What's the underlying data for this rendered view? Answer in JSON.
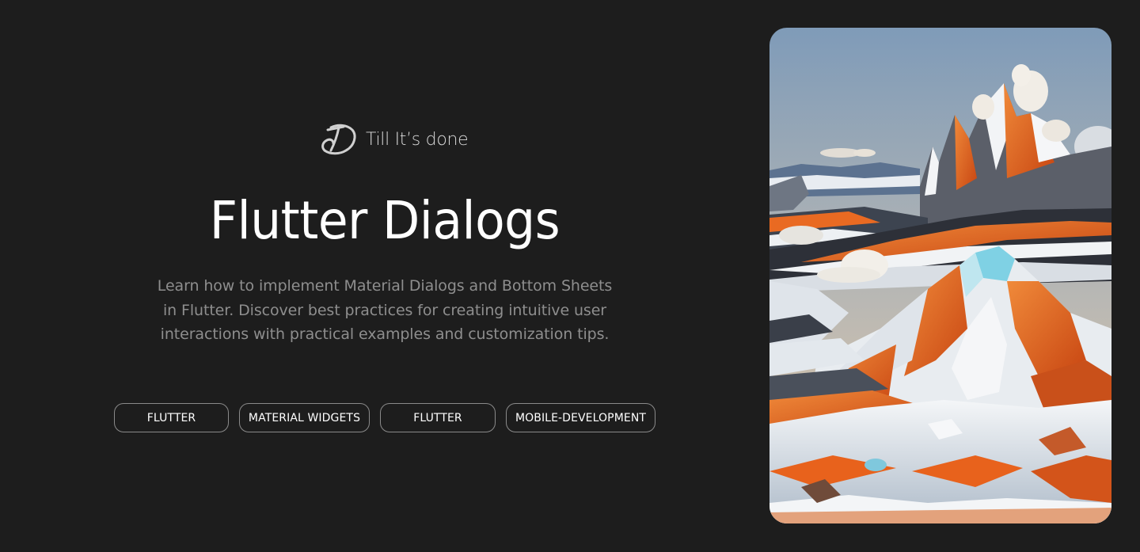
{
  "brand": {
    "name": "Till It’s done",
    "logo_icon": "td-monogram-logo"
  },
  "hero": {
    "title": "Flutter Dialogs",
    "description": "Learn how to implement Material Dialogs and Bottom Sheets in Flutter. Discover best practices for creating intuitive user interactions with practical examples and customization tips."
  },
  "tags": [
    {
      "label": "FLUTTER"
    },
    {
      "label": "MATERIAL WIDGETS"
    },
    {
      "label": "FLUTTER"
    },
    {
      "label": "MOBILE-DEVELOPMENT"
    }
  ],
  "image": {
    "subject": "snowy-orange-mountains-illustration"
  },
  "colors": {
    "background": "#1d1d1d",
    "title": "#ffffff",
    "description": "#8e8e8e",
    "tag_border": "#8a8a8a",
    "accent_orange": "#e8651e"
  }
}
